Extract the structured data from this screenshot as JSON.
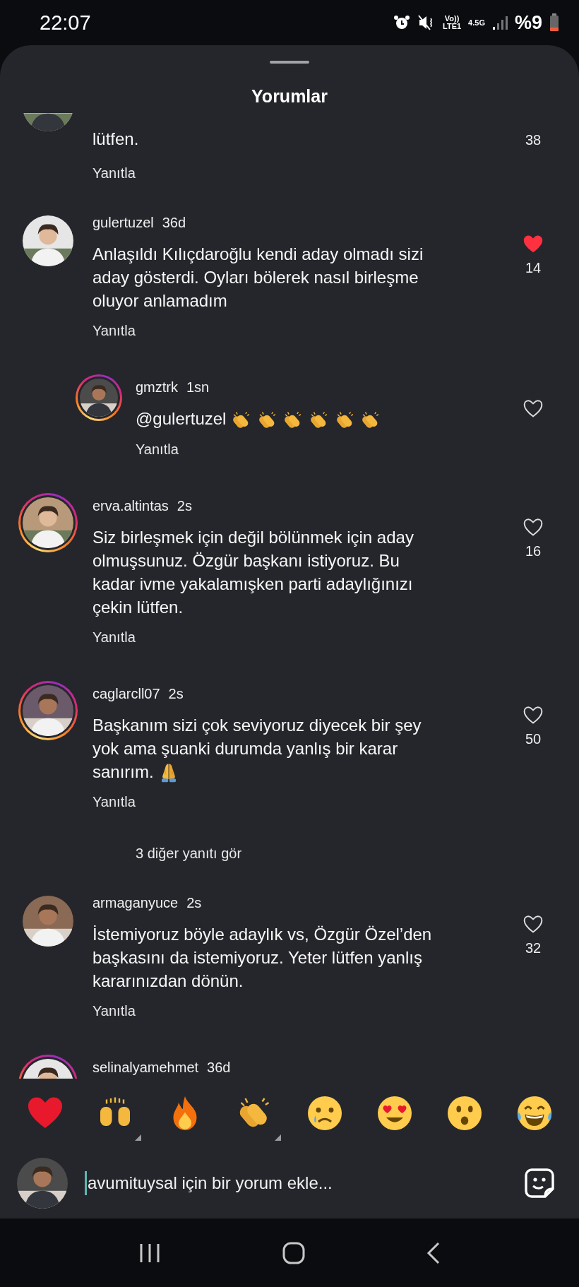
{
  "status_bar": {
    "time": "22:07",
    "network": "Vo))",
    "network_sub": "LTE1",
    "data": "4.5G",
    "battery": "%9"
  },
  "sheet": {
    "title": "Yorumlar"
  },
  "comments": [
    {
      "kind": "partial",
      "lines": [
        "lütfen."
      ],
      "likes": "38",
      "reply_label": "Yanıtla"
    },
    {
      "kind": "comment",
      "username": "gulertuzel",
      "time": "36d",
      "ring": false,
      "lines": [
        "Anlaşıldı Kılıçdaroğlu kendi aday olmadı sizi",
        "aday gösterdi. Oyları bölerek nasıl birleşme",
        "oluyor anlamadım"
      ],
      "liked": true,
      "likes": "14",
      "reply_label": "Yanıtla"
    },
    {
      "kind": "reply",
      "username": "gmztrk",
      "time": "1sn",
      "ring": true,
      "lines": [
        "@gulertuzel"
      ],
      "emojis": [
        {
          "kind": "clap"
        },
        {
          "kind": "clap"
        },
        {
          "kind": "clap"
        },
        {
          "kind": "clap"
        },
        {
          "kind": "clap"
        },
        {
          "kind": "clap"
        }
      ],
      "liked": false,
      "reply_label": "Yanıtla"
    },
    {
      "kind": "comment",
      "username": "erva.altintas",
      "time": "2s",
      "ring": true,
      "lines": [
        "Siz birleşmek için değil bölünmek için aday",
        "olmuşsunuz. Özgür başkanı istiyoruz. Bu",
        "kadar ivme yakalamışken parti adaylığınızı",
        "çekin lütfen."
      ],
      "liked": false,
      "likes": "16",
      "reply_label": "Yanıtla"
    },
    {
      "kind": "comment",
      "username": "caglarcll07",
      "time": "2s",
      "ring": true,
      "lines": [
        "Başkanım sizi çok seviyoruz diyecek bir şey",
        "yok ama şuanki durumda yanlış bir karar",
        "sanırım."
      ],
      "emojis": [
        {
          "kind": "pray"
        }
      ],
      "liked": false,
      "likes": "50",
      "reply_label": "Yanıtla"
    },
    {
      "kind": "more",
      "text": "3 diğer yanıtı gör"
    },
    {
      "kind": "comment",
      "username": "armaganyuce",
      "time": "2s",
      "ring": false,
      "lines": [
        "İstemiyoruz böyle adaylık vs, Özgür Özel’den",
        "başkasını da istemiyoruz. Yeter lütfen yanlış",
        "kararınızdan dönün."
      ],
      "liked": false,
      "likes": "32",
      "reply_label": "Yanıtla"
    },
    {
      "kind": "cut",
      "username": "selinalyamehmet",
      "time": "36d",
      "ring": true
    }
  ],
  "reactions": [
    {
      "kind": "heart",
      "variants": false
    },
    {
      "kind": "raised-hands",
      "variants": true
    },
    {
      "kind": "fire",
      "variants": false
    },
    {
      "kind": "clap",
      "variants": true
    },
    {
      "kind": "crying",
      "variants": false
    },
    {
      "kind": "heart-eyes",
      "variants": false
    },
    {
      "kind": "surprised",
      "variants": false
    },
    {
      "kind": "laughing",
      "variants": false
    }
  ],
  "composer": {
    "placeholder": "avumituysal için bir yorum ekle..."
  }
}
